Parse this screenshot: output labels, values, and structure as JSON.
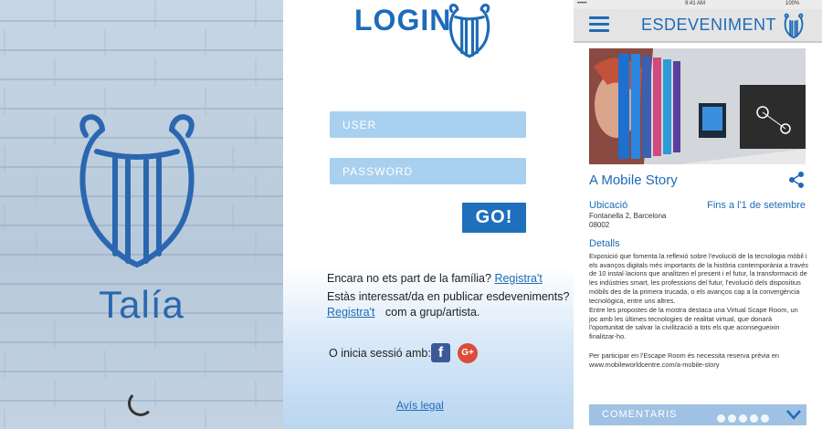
{
  "splash": {
    "app_name": "Talía"
  },
  "login": {
    "title": "LOGIN",
    "user_placeholder": "USER",
    "password_placeholder": "PASSWORD",
    "go_label": "GO!",
    "line1_text": "Encara no ets part de la família?",
    "line1_link": "Registra't",
    "line2_text": "Estàs interessat/da en publicar esdeveniments?",
    "line3_link": "Registra't",
    "line3_text": "com a grup/artista.",
    "social_label": "O inicia sessió amb:",
    "facebook_glyph": "f",
    "gplus_glyph": "G+",
    "legal_link": "Avís legal"
  },
  "event": {
    "statusbar": {
      "carrier": "•••••",
      "time": "9:41 AM",
      "battery": "100%"
    },
    "appbar_title": "ESDEVENIMENT",
    "title": "A Mobile Story",
    "location_label": "Ubicació",
    "date_label": "Fins a l'1 de setembre",
    "address_line1": "Fontanella 2, Barcelona",
    "address_line2": "08002",
    "details_label": "Detalls",
    "paragraph1": "Exposició que fomenta la reflexió sobre l'evolució de la tecnologia mòbil i els avanços digitals més importants de la història contemporània a través de 10 instal·lacions que analitzen el present i el futur, la transformació de les indústries smart, les professions del futur, l'evolució dels dispositius mòbils des de la primera trucada, o els avanços cap a la convergència tecnològica, entre uns altres.",
    "paragraph2": "Entre les propostes de la mostra destaca una Virtual Scape Room, un joc amb les últimes tecnologies de realitat virtual, que donarà l'oportunitat de salvar la civilització a tots els que aconsegueixin finalitzar-ho.",
    "paragraph3": "Per participar en l'Escape Room és necessita reserva prèvia en www.mobileworldcentre.com/a-mobile-story",
    "comments_label": "COMENTARIS",
    "comment_dots": 5
  },
  "colors": {
    "brand_blue": "#1e6bb8",
    "field_blue": "#a9d0ee",
    "button_blue": "#1f6fbd",
    "comments_bar": "#9fc2e4"
  }
}
